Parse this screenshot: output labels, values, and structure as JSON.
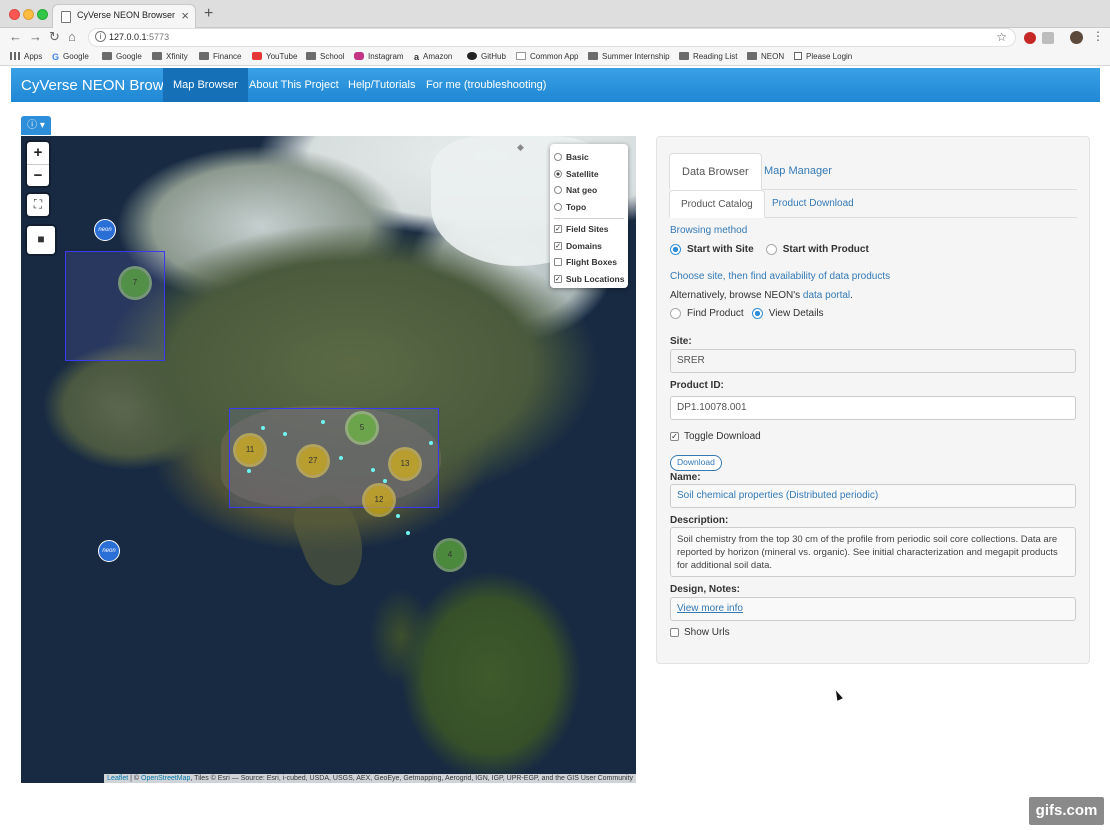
{
  "browser": {
    "tab_title": "CyVerse NEON Browser",
    "url_host": "127.0.0.1",
    "url_port": ":5773",
    "bookmarks": [
      "Apps",
      "Google",
      "Google",
      "Xfinity",
      "Finance",
      "YouTube",
      "School",
      "Instagram",
      "Amazon",
      "GitHub",
      "Common App",
      "Summer Internship",
      "Reading List",
      "NEON",
      "Please Login"
    ]
  },
  "navbar": {
    "brand": "CyVerse NEON Browser",
    "links": [
      "Map Browser",
      "About This Project",
      "Help/Tutorials",
      "For me (troubleshooting)"
    ]
  },
  "map": {
    "zoom_in": "+",
    "zoom_out": "−",
    "base_layers": [
      "Basic",
      "Satellite",
      "Nat geo",
      "Topo"
    ],
    "selected_base": "Satellite",
    "overlays": [
      "Field Sites",
      "Domains",
      "Flight Boxes",
      "Sub Locations"
    ],
    "overlays_checked": [
      true,
      true,
      false,
      true
    ],
    "clusters": [
      "7",
      "11",
      "27",
      "5",
      "13",
      "12",
      "4"
    ],
    "neon_marker_label": "neon",
    "attribution_leaflet": "Leaflet",
    "attribution_osm": "OpenStreetMap",
    "attribution_rest": ", Tiles © Esri — Source: Esri, i-cubed, USDA, USGS, AEX, GeoEye, Getmapping, Aerogrid, IGN, IGP, UPR-EGP, and the GIS User Community",
    "attribution_sep": " | © "
  },
  "panel": {
    "tab_data_browser": "Data Browser",
    "tab_map_manager": "Map Manager",
    "tab_product_catalog": "Product Catalog",
    "tab_product_download": "Product Download",
    "browsing_method": "Browsing method",
    "start_with_site": "Start with Site",
    "start_with_product": "Start with Product",
    "choose_site": "Choose site, then find availability of data products",
    "alt_prefix": "Alternatively, browse NEON's ",
    "alt_link": "data portal",
    "alt_suffix": ".",
    "find_product": "Find Product",
    "view_details": "View Details",
    "site_label": "Site:",
    "site_value": "SRER",
    "product_id_label": "Product ID:",
    "product_id_value": "DP1.10078.001",
    "toggle_download": "Toggle Download",
    "download_button": "Download",
    "name_label": "Name:",
    "name_value": "Soil chemical properties (Distributed periodic)",
    "description_label": "Description:",
    "description_value": "Soil chemistry from the top 30 cm of the profile from periodic soil core collections. Data are reported by horizon (mineral vs. organic). See initial characterization and megapit products for additional soil data.",
    "design_label": "Design, Notes:",
    "view_more": "View more info",
    "show_urls": "Show Urls"
  },
  "watermark": "gifs.com"
}
